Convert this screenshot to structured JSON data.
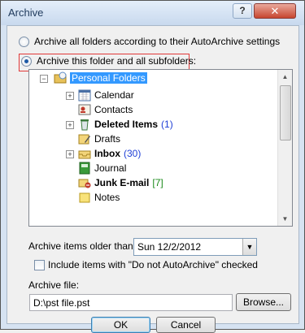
{
  "window": {
    "title": "Archive",
    "help": "?",
    "close": "✕"
  },
  "options": {
    "archive_all_label": "Archive all folders according to their AutoArchive settings",
    "archive_this_label": "Archive this folder and all subfolders:"
  },
  "tree": {
    "root_label": "Personal Folders",
    "items": [
      {
        "label": "Calendar",
        "count": "",
        "expand": "+"
      },
      {
        "label": "Contacts",
        "count": "",
        "expand": ""
      },
      {
        "label": "Deleted Items",
        "count": "(1)",
        "expand": "+"
      },
      {
        "label": "Drafts",
        "count": "",
        "expand": ""
      },
      {
        "label": "Inbox",
        "count": "(30)",
        "expand": "+"
      },
      {
        "label": "Journal",
        "count": "",
        "expand": ""
      },
      {
        "label": "Junk E-mail",
        "count": "[7]",
        "expand": ""
      },
      {
        "label": "Notes",
        "count": "",
        "expand": ""
      }
    ]
  },
  "older_than": {
    "label": "Archive items older than:",
    "value": "Sun 12/2/2012"
  },
  "include_checkbox": {
    "label": "Include items with \"Do not AutoArchive\" checked"
  },
  "archive_file": {
    "label": "Archive file:",
    "value": "D:\\pst file.pst",
    "browse": "Browse..."
  },
  "buttons": {
    "ok": "OK",
    "cancel": "Cancel"
  },
  "colors": {
    "selection": "#3399ff",
    "highlight_border": "#e03838",
    "count_blue": "#1f3fd6",
    "count_green": "#1a8a1a"
  }
}
